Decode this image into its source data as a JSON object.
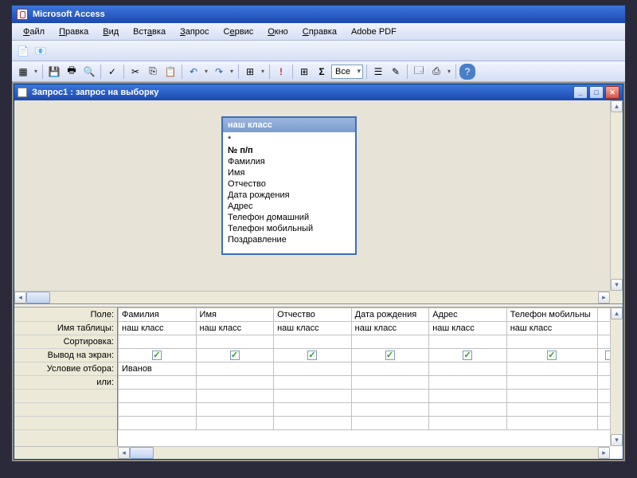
{
  "app": {
    "title": "Microsoft Access"
  },
  "menu": {
    "file": "Файл",
    "edit": "Правка",
    "view": "Вид",
    "insert": "Вставка",
    "query": "Запрос",
    "service": "Сервис",
    "window": "Окно",
    "help": "Справка",
    "adobe": "Adobe PDF"
  },
  "toolbar": {
    "scope": "Все"
  },
  "child": {
    "title": "Запрос1 : запрос на выборку"
  },
  "source_table": {
    "name": "наш класс",
    "fields": [
      "*",
      "№ п/п",
      "Фамилия",
      "Имя",
      "Отчество",
      "Дата рождения",
      "Адрес",
      "Телефон домашний",
      "Телефон мобильный",
      "Поздравление"
    ]
  },
  "grid": {
    "labels": {
      "field": "Поле:",
      "table": "Имя таблицы:",
      "sort": "Сортировка:",
      "show": "Вывод на экран:",
      "criteria": "Условие отбора:",
      "or": "или:"
    },
    "columns": [
      {
        "field": "Фамилия",
        "table": "наш класс",
        "show": true,
        "criteria": "Иванов"
      },
      {
        "field": "Имя",
        "table": "наш класс",
        "show": true,
        "criteria": ""
      },
      {
        "field": "Отчество",
        "table": "наш класс",
        "show": true,
        "criteria": ""
      },
      {
        "field": "Дата рождения",
        "table": "наш класс",
        "show": true,
        "criteria": ""
      },
      {
        "field": "Адрес",
        "table": "наш класс",
        "show": true,
        "criteria": ""
      },
      {
        "field": "Телефон мобильны",
        "table": "наш класс",
        "show": true,
        "criteria": ""
      }
    ]
  }
}
